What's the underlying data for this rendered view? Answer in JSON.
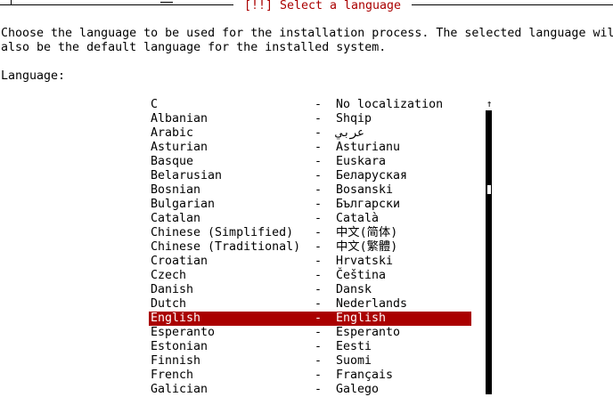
{
  "dialog": {
    "title": "[!!] Select a language",
    "description_line1": "Choose the language to be used for the installation process. The selected language will",
    "description_line2": "also be the default language for the installed system.",
    "field_label": "Language:"
  },
  "language_list": {
    "separator": "-",
    "selected_index": 15,
    "items": [
      {
        "name": "C",
        "native": "No localization"
      },
      {
        "name": "Albanian",
        "native": "Shqip"
      },
      {
        "name": "Arabic",
        "native": "عربي"
      },
      {
        "name": "Asturian",
        "native": "Asturianu"
      },
      {
        "name": "Basque",
        "native": "Euskara"
      },
      {
        "name": "Belarusian",
        "native": "Беларуская"
      },
      {
        "name": "Bosnian",
        "native": "Bosanski"
      },
      {
        "name": "Bulgarian",
        "native": "Български"
      },
      {
        "name": "Catalan",
        "native": "Català"
      },
      {
        "name": "Chinese (Simplified)",
        "native": "中文(简体)"
      },
      {
        "name": "Chinese (Traditional)",
        "native": "中文(繁體)"
      },
      {
        "name": "Croatian",
        "native": "Hrvatski"
      },
      {
        "name": "Czech",
        "native": "Čeština"
      },
      {
        "name": "Danish",
        "native": "Dansk"
      },
      {
        "name": "Dutch",
        "native": "Nederlands"
      },
      {
        "name": "English",
        "native": "English"
      },
      {
        "name": "Esperanto",
        "native": "Esperanto"
      },
      {
        "name": "Estonian",
        "native": "Eesti"
      },
      {
        "name": "Finnish",
        "native": "Suomi"
      },
      {
        "name": "French",
        "native": "Français"
      },
      {
        "name": "Galician",
        "native": "Galego"
      }
    ]
  },
  "scrollbar": {
    "up_arrow": "↑"
  },
  "colors": {
    "accent": "#aa0000",
    "background": "#ffffff",
    "text": "#000000"
  }
}
